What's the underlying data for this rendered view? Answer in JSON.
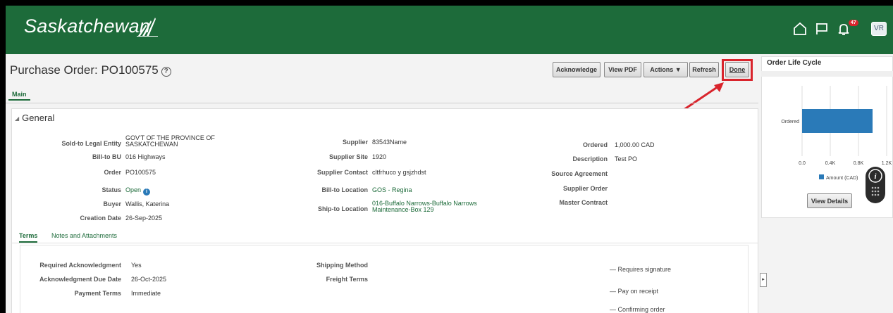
{
  "header": {
    "logo_text": "Saskatchewan",
    "notification_count": "47",
    "avatar_initials": "VR"
  },
  "page": {
    "title": "Purchase Order: PO100575",
    "help_icon": "?"
  },
  "toolbar": {
    "acknowledge": "Acknowledge",
    "view_pdf": "View PDF",
    "actions": "Actions ▼",
    "refresh": "Refresh",
    "done": "Done"
  },
  "tabs": {
    "main": "Main"
  },
  "general": {
    "section_title": "General",
    "sold_to_label": "Sold-to Legal Entity",
    "sold_to_value_1": "GOV'T OF THE PROVINCE OF",
    "sold_to_value_2": "SASKATCHEWAN",
    "bill_to_bu_label": "Bill-to BU",
    "bill_to_bu_value": "016 Highways",
    "order_label": "Order",
    "order_value": "PO100575",
    "status_label": "Status",
    "status_value": "Open",
    "buyer_label": "Buyer",
    "buyer_value": "Wallis, Katerina",
    "creation_date_label": "Creation Date",
    "creation_date_value": "26-Sep-2025",
    "supplier_label": "Supplier",
    "supplier_value": "83543Name",
    "supplier_site_label": "Supplier Site",
    "supplier_site_value": "1920",
    "supplier_contact_label": "Supplier Contact",
    "supplier_contact_value": "cltfrhuco y gsjzhdst",
    "bill_to_location_label": "Bill-to Location",
    "bill_to_location_value": "GOS - Regina",
    "ship_to_location_label": "Ship-to Location",
    "ship_to_location_value_1": "016-Buffalo Narrows-Buffalo Narrows",
    "ship_to_location_value_2": "Maintenance-Box 129",
    "ordered_label": "Ordered",
    "ordered_value": "1,000.00 CAD",
    "description_label": "Description",
    "description_value": "Test PO",
    "source_agreement_label": "Source Agreement",
    "supplier_order_label": "Supplier Order",
    "master_contract_label": "Master Contract"
  },
  "subtabs": {
    "terms": "Terms",
    "notes": "Notes and Attachments"
  },
  "terms": {
    "req_ack_label": "Required Acknowledgment",
    "req_ack_value": "Yes",
    "ack_due_label": "Acknowledgment Due Date",
    "ack_due_value": "26-Oct-2025",
    "payment_terms_label": "Payment Terms",
    "payment_terms_value": "Immediate",
    "shipping_method_label": "Shipping Method",
    "freight_terms_label": "Freight Terms",
    "requires_signature": "Requires signature",
    "pay_on_receipt": "Pay on receipt",
    "confirming_order": "Confirming order"
  },
  "right_panel": {
    "title": "Order Life Cycle",
    "view_details": "View Details",
    "legend": "Amount (CAD)",
    "info": "i"
  },
  "chart_data": {
    "type": "bar",
    "categories": [
      "Ordered"
    ],
    "series": [
      {
        "name": "Amount (CAD)",
        "values": [
          1000
        ]
      }
    ],
    "xlim": [
      0,
      1200
    ],
    "tick_labels": [
      "0.0",
      "0.4K",
      "0.8K",
      "1.2K"
    ],
    "ticks": [
      0,
      400,
      800,
      1200
    ],
    "color": "#2a7ab8",
    "orientation": "horizontal"
  },
  "colors": {
    "brand_green": "#1d6b3a",
    "highlight_red": "#d9242c",
    "bar_blue": "#2a7ab8"
  }
}
